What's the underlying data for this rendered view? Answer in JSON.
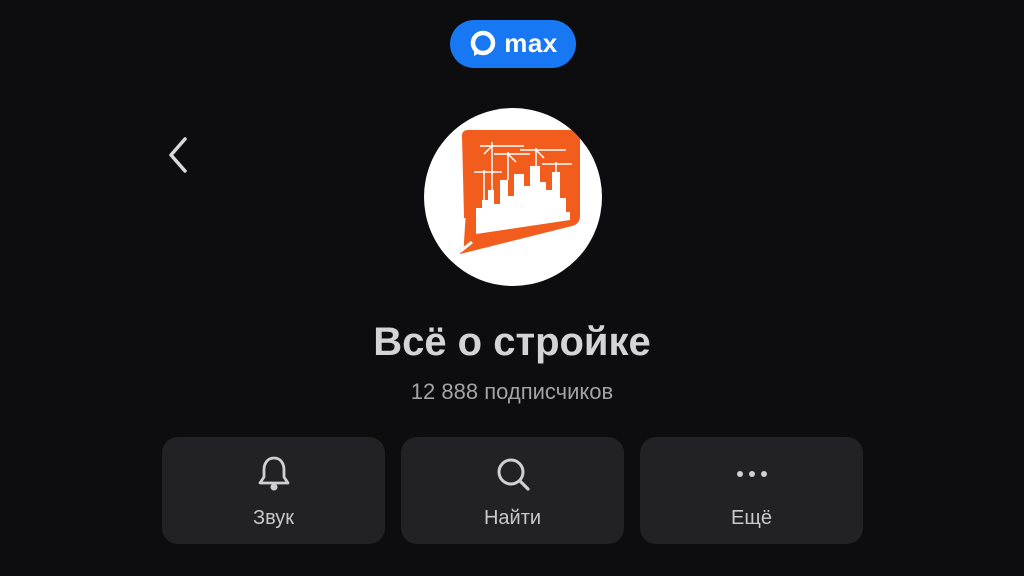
{
  "brand": {
    "name": "max",
    "color": "#1877f2"
  },
  "header": {
    "back_icon": "chevron-left-icon"
  },
  "channel": {
    "title": "Всё о стройке",
    "subscribers": "12 888 подписчиков",
    "avatar_icon": "construction-city-icon",
    "avatar_color": "#f25c1c"
  },
  "actions": [
    {
      "label": "Звук",
      "icon": "bell-icon"
    },
    {
      "label": "Найти",
      "icon": "search-icon"
    },
    {
      "label": "Ещё",
      "icon": "more-dots-icon"
    }
  ],
  "colors": {
    "background": "#0d0d0f",
    "button_background": "#222226",
    "text_primary": "#d4d4d6",
    "text_secondary": "#a3a3a7"
  }
}
